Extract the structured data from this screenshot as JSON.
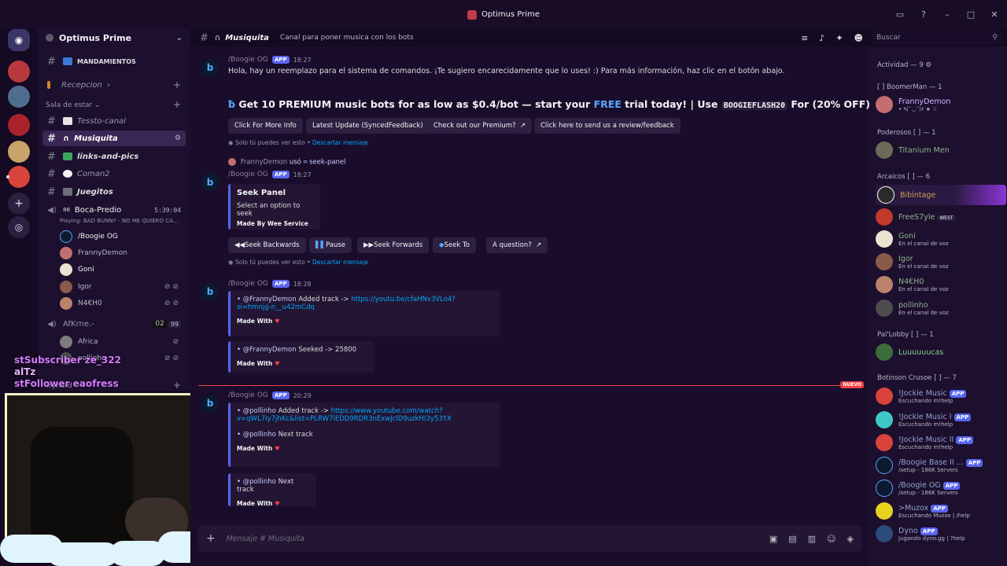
{
  "window": {
    "title": "Optimus Prime"
  },
  "guild": {
    "name": "Optimus Prime"
  },
  "channels": [
    {
      "name": "MANDAMIENTOS",
      "type": "text"
    },
    {
      "name": "Recepcion",
      "type": "category"
    },
    {
      "name": "Sala de estar",
      "type": "category"
    },
    {
      "name": "Tessto-canal",
      "type": "text"
    },
    {
      "name": "Musiquita",
      "type": "text",
      "active": true
    },
    {
      "name": "links-and-pics",
      "type": "text"
    },
    {
      "name": "Coman2",
      "type": "text"
    },
    {
      "name": "Juegitos",
      "type": "text"
    }
  ],
  "voice": {
    "channel1": {
      "name": "Boca-Predio",
      "timer": "5:39:04",
      "playing": "Playing: BAD BUNNY - NO ME QUIERO CA...",
      "count": "88"
    },
    "users1": [
      "/Boogie OG",
      "FrannyDemon",
      "Goni",
      "Igor",
      "N4€H0"
    ],
    "channel2": {
      "name": "AfKrne.-",
      "count_a": "02",
      "count_b": "99"
    },
    "users2": [
      "Africa",
      "pollinho"
    ],
    "category3": "Tryhard"
  },
  "overlay": {
    "line1": "stSubscriber ze_322",
    "line2": "alTz",
    "line3": "stFollower eaofress"
  },
  "chat_header": {
    "channel": "Musiquita",
    "topic": "Canal para poner musica con los bots",
    "search_placeholder": "Buscar"
  },
  "messages": {
    "m1": {
      "author": "/Boogie OG",
      "badge": "APP",
      "time": "18:27",
      "text": "Hola, hay un reemplazo para el sistema de comandos. ¡Te sugiero encarecidamente que lo uses! :) Para más información, haz clic en el botón abajo.",
      "promo_start": "Get 10 PREMIUM music bots for as low as $0.4/bot — start your ",
      "promo_free": "FREE",
      "promo_mid": " trial today! | Use ",
      "promo_code": "BOOGIEFLASH20",
      "promo_end": " For (20% OFF)",
      "buttons": [
        "Click For More Info",
        "Latest Update (SyncedFeedback)",
        "Check out our Premium?",
        "Click here to send us a review/feedback"
      ],
      "ephemeral": "Solo tú puedes ver esto • ",
      "dismiss": "Descartar mensaje"
    },
    "m2": {
      "reply_user": "FrannyDemon",
      "reply_used": "usó",
      "reply_cmd": "seek-panel",
      "author": "/Boogie OG",
      "badge": "APP",
      "time": "18:27",
      "embed_title": "Seek Panel",
      "embed_desc": "Select an option to seek",
      "embed_foot": "Made By Wee Service",
      "buttons": [
        "Seek Backwards",
        "Pause",
        "Seek Forwards",
        "Seek To",
        "A question?"
      ],
      "ephemeral": "Solo tú puedes ver esto • ",
      "dismiss": "Descartar mensaje"
    },
    "m3": {
      "author": "/Boogie OG",
      "badge": "APP",
      "time": "18:28",
      "e1_mention": "@FrannyDemon",
      "e1_text": "Added track ->",
      "e1_url1": "https://youtu.be/cfaHNv3VLo4?",
      "e1_url2": "si=hmnjg-n__u42mCdq",
      "made": "Made With",
      "e2_mention": "@FrannyDemon",
      "e2_text": "Seeked -> 25800"
    },
    "new_tag": "NUEVO",
    "m4": {
      "author": "/Boogie OG",
      "badge": "APP",
      "time": "20:29",
      "e1_mention": "@pollinho",
      "e1_text": "Added track ->",
      "e1_url1": "https://www.youtube.com/watch?",
      "e1_url2": "v=qWL7Iy7jhKc&list=PLRW7iEDD9RDR3nExwJclD9uzkHI3y53YX",
      "e1_next_mention": "@pollinho",
      "e1_next": "Next track",
      "made": "Made With",
      "e2_mention": "@pollinho",
      "e2_text": "Next track"
    }
  },
  "composer": {
    "placeholder": "Mensaje #  Musiquita"
  },
  "members": {
    "groups": [
      {
        "label": "Actividad — 9",
        "members": []
      },
      {
        "label": "[ ] BoomerMan — 1",
        "members": [
          {
            "name": "FrannyDemon",
            "status": "• ٩(˘◡˘)۶ ★ ☆"
          }
        ]
      },
      {
        "label": "Poderosos [ ] — 1",
        "members": [
          {
            "name": "Titanium Men",
            "status": ""
          }
        ]
      },
      {
        "label": "Arcaicos [ ] — 6",
        "members": [
          {
            "name": "Bibintage",
            "status": ""
          },
          {
            "name": "FreeS7yle",
            "status": "",
            "tag": "WEST"
          },
          {
            "name": "Goni",
            "status": "En el canal de voz"
          },
          {
            "name": "Igor",
            "status": "En el canal de voz"
          },
          {
            "name": "N4€H0",
            "status": "En el canal de voz"
          },
          {
            "name": "pollinho",
            "status": "En el canal de voz"
          }
        ]
      },
      {
        "label": "Pal'Lobby [ ] — 1",
        "members": [
          {
            "name": "Luuuuuucas",
            "status": ""
          }
        ]
      },
      {
        "label": "Botinson Crusoe [ ] — 7",
        "members": [
          {
            "name": "!Jockie Music",
            "status": "Escuchando m!help",
            "badge": "APP"
          },
          {
            "name": "!Jockie Music I",
            "status": "Escuchando m!help",
            "badge": "APP"
          },
          {
            "name": "!Jockie Music II",
            "status": "Escuchando m!help",
            "badge": "APP"
          },
          {
            "name": "/Boogie Base II ...",
            "status": "/setup - 186K Servers",
            "badge": "APP"
          },
          {
            "name": "/Boogie OG",
            "status": "/setup - 186K Servers",
            "badge": "APP"
          },
          {
            "name": ">Muzox",
            "status": "Escuchando Muzox | /help",
            "badge": "APP"
          },
          {
            "name": "Dyno",
            "status": "Jugando dyno.gg | ?help",
            "badge": "APP"
          }
        ]
      }
    ]
  }
}
